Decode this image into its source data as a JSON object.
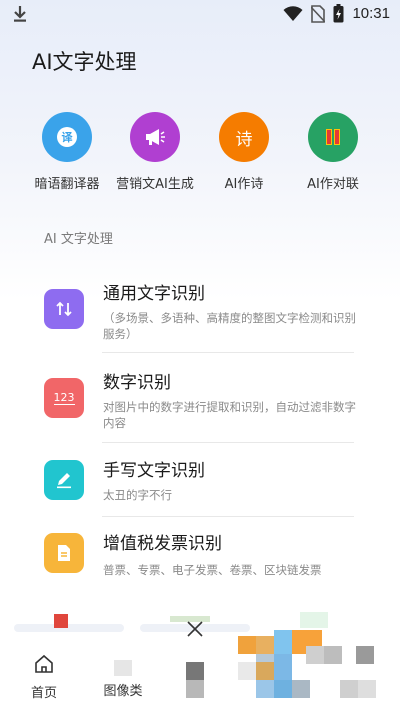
{
  "status": {
    "time": "10:31"
  },
  "app_title": "AI文字处理",
  "quick_actions": [
    {
      "label": "暗语翻译器",
      "icon": "translate-icon",
      "color": "#3aa3ea",
      "glyph": "译"
    },
    {
      "label": "营销文AI生成",
      "icon": "megaphone-icon",
      "color": "#b03fd1",
      "glyph": "📢"
    },
    {
      "label": "AI作诗",
      "icon": "poem-icon",
      "color": "#f57c00",
      "glyph": "诗"
    },
    {
      "label": "AI作对联",
      "icon": "couplet-icon",
      "color": "#27a264",
      "glyph": "联"
    }
  ],
  "section_label": "AI 文字处理",
  "cards": [
    {
      "title": "通用文字识别",
      "desc": "（多场景、多语种、高精度的整图文字检测和识别服务）",
      "icon": "sort-icon",
      "color": "#8e6cf0"
    },
    {
      "title": "数字识别",
      "desc": "对图片中的数字进行提取和识别，自动过滤非数字内容",
      "icon": "numbers-icon",
      "color": "#f16668",
      "glyph": "123"
    },
    {
      "title": "手写文字识别",
      "desc": "太丑的字不行",
      "icon": "pen-icon",
      "color": "#21c5cf"
    },
    {
      "title": "增值税发票识别",
      "desc": "普票、专票、电子发票、卷票、区块链发票",
      "icon": "invoice-icon",
      "color": "#f7b53a"
    }
  ],
  "bottom_nav": [
    {
      "label": "首页",
      "icon": "home-icon"
    },
    {
      "label": "图像类",
      "icon": "image-icon"
    }
  ]
}
